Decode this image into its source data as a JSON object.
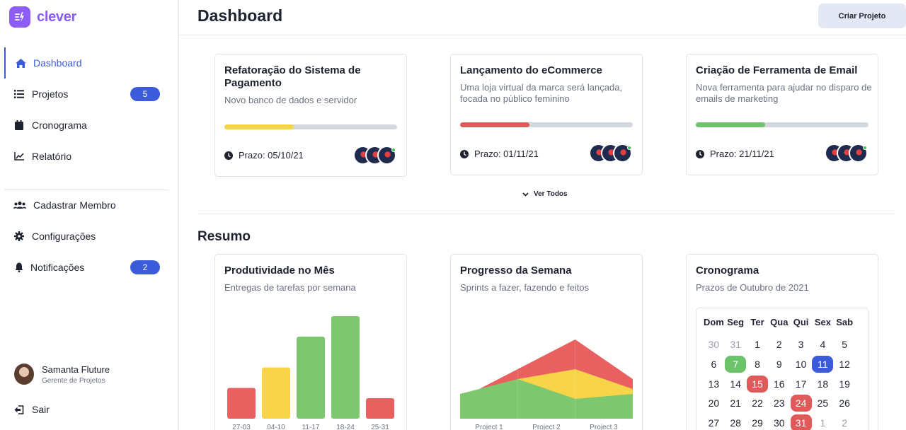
{
  "brand": {
    "name": "clever",
    "accent": "#8b5cf6"
  },
  "sidebar": {
    "items": [
      {
        "label": "Dashboard",
        "icon": "home-icon",
        "active": true
      },
      {
        "label": "Projetos",
        "icon": "list-icon",
        "badge": "5"
      },
      {
        "label": "Cronograma",
        "icon": "calendar-icon"
      },
      {
        "label": "Relatório",
        "icon": "chart-line-icon"
      }
    ],
    "items2": [
      {
        "label": "Cadastrar Membro",
        "icon": "users-icon"
      },
      {
        "label": "Configurações",
        "icon": "gear-icon"
      },
      {
        "label": "Notificações",
        "icon": "bell-icon",
        "badge": "2"
      }
    ],
    "user": {
      "name": "Samanta Fluture",
      "role": "Gerente de Projetos"
    },
    "logout_label": "Sair"
  },
  "header": {
    "title": "Dashboard",
    "action_label": "Criar Projeto"
  },
  "projects": [
    {
      "title": "Refatoração do Sistema de Pagamento",
      "desc": "Novo banco de dados e servidor",
      "progress": 0.4,
      "color": "#f5d547",
      "deadline": "Prazo: 05/10/21"
    },
    {
      "title": "Lançamento do eCommerce",
      "desc": "Uma loja virtual da marca será lançada, focada no público feminino",
      "progress": 0.4,
      "color": "#e05a5a",
      "deadline": "Prazo: 01/11/21"
    },
    {
      "title": "Criação de Ferramenta de Email",
      "desc": "Nova ferramenta para ajudar no disparo de emails de marketing",
      "progress": 0.4,
      "color": "#6cc46a",
      "deadline": "Prazo: 21/11/21"
    }
  ],
  "see_all_label": "Ver Todos",
  "summary": {
    "title": "Resumo",
    "productivity": {
      "title": "Produtividade no Mês",
      "subtitle": "Entregas de tarefas por semana"
    },
    "weekly": {
      "title": "Progresso da Semana",
      "subtitle": "Sprints a fazer, fazendo e feitos"
    },
    "schedule": {
      "title": "Cronograma",
      "subtitle": "Prazos de Outubro de 2021"
    }
  },
  "chart_data": [
    {
      "type": "bar",
      "categories": [
        "27-03",
        "04-10",
        "11-17",
        "18-24",
        "25-31"
      ],
      "values": [
        3,
        5,
        8,
        10,
        2
      ],
      "colors": [
        "#e86060",
        "#f8d548",
        "#7dc86f",
        "#7dc86f",
        "#e86060"
      ],
      "ylim": [
        0,
        10
      ]
    },
    {
      "type": "area",
      "categories": [
        "Project 1",
        "Project 2",
        "Project 3"
      ],
      "ylim": [
        0,
        10
      ],
      "series": [
        {
          "color": "#e86060",
          "values": [
            2,
            5,
            8,
            4
          ]
        },
        {
          "color": "#f8d548",
          "values": [
            2,
            4,
            5,
            3
          ]
        },
        {
          "color": "#7dc86f",
          "values": [
            2.5,
            4,
            2,
            2.5
          ]
        }
      ]
    }
  ],
  "calendar": {
    "weekdays": [
      "Dom",
      "Seg",
      "Ter",
      "Qua",
      "Qui",
      "Sex",
      "Sab"
    ],
    "days": [
      {
        "d": "30",
        "s": "muted"
      },
      {
        "d": "31",
        "s": "muted"
      },
      {
        "d": "1"
      },
      {
        "d": "2"
      },
      {
        "d": "3"
      },
      {
        "d": "4"
      },
      {
        "d": "5"
      },
      {
        "d": "6"
      },
      {
        "d": "7",
        "s": "green"
      },
      {
        "d": "8"
      },
      {
        "d": "9"
      },
      {
        "d": "10"
      },
      {
        "d": "11",
        "s": "blue"
      },
      {
        "d": "12"
      },
      {
        "d": "13"
      },
      {
        "d": "14"
      },
      {
        "d": "15",
        "s": "red"
      },
      {
        "d": "16"
      },
      {
        "d": "17"
      },
      {
        "d": "18"
      },
      {
        "d": "19"
      },
      {
        "d": "20"
      },
      {
        "d": "21"
      },
      {
        "d": "22"
      },
      {
        "d": "23"
      },
      {
        "d": "24",
        "s": "red"
      },
      {
        "d": "25"
      },
      {
        "d": "26"
      },
      {
        "d": "27"
      },
      {
        "d": "28"
      },
      {
        "d": "29"
      },
      {
        "d": "30"
      },
      {
        "d": "31",
        "s": "red"
      },
      {
        "d": "1",
        "s": "muted"
      },
      {
        "d": "2",
        "s": "muted"
      }
    ]
  }
}
